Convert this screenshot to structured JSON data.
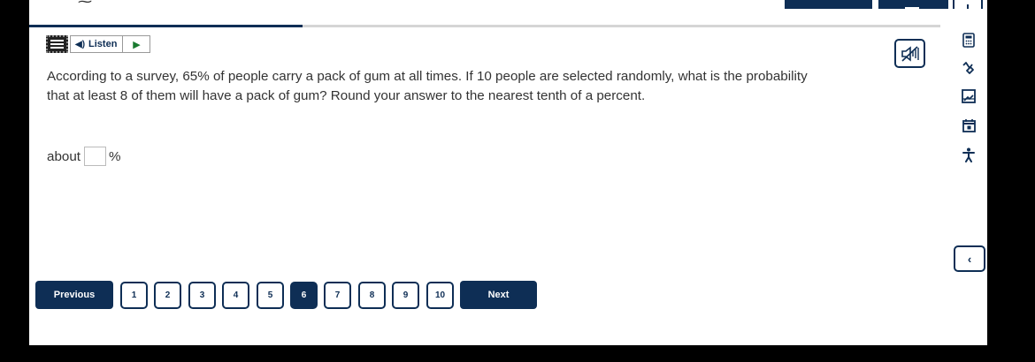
{
  "toolbar": {
    "listen_label": "Listen"
  },
  "question": {
    "text": "According to a survey, 65% of people carry a pack of gum at all times. If 10 people are selected randomly, what is the probability that at least 8 of them will have a pack of gum? Round your answer to the nearest tenth of a percent.",
    "answer_prefix": "about",
    "answer_value": "",
    "answer_suffix": "%"
  },
  "progress": {
    "current": 6,
    "total": 10
  },
  "side_tools": [
    "calculator-icon",
    "highlighter-icon",
    "reference-sheet-icon",
    "calendar-icon",
    "accessibility-icon"
  ],
  "nav": {
    "previous_label": "Previous",
    "next_label": "Next",
    "pages": [
      "1",
      "2",
      "3",
      "4",
      "5",
      "6",
      "7",
      "8",
      "9",
      "10"
    ],
    "current_page": "6"
  },
  "colors": {
    "navy": "#0e2e55",
    "play_green": "#1a7a30"
  }
}
